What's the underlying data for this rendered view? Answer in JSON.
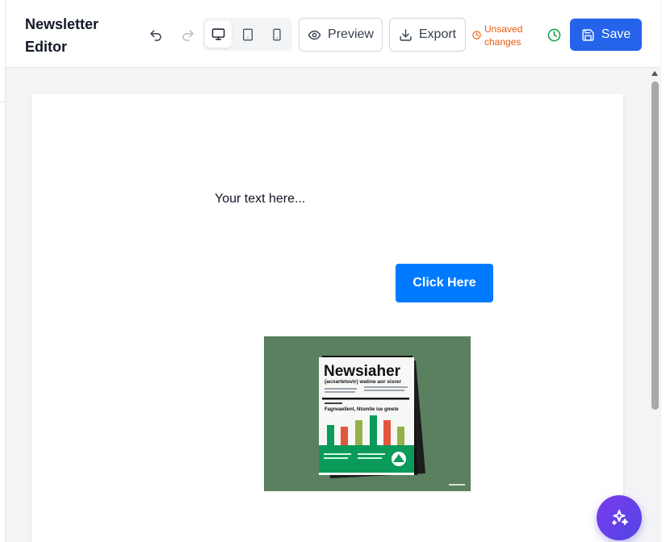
{
  "header": {
    "title": "Newsletter Editor",
    "preview_label": "Preview",
    "export_label": "Export",
    "status_text": "Unsaved changes",
    "save_label": "Save"
  },
  "canvas": {
    "text_block": "Your text here...",
    "button_label": "Click Here",
    "image": {
      "headline": "Newsiaher",
      "subhead": "(acnartetovir) watine aor sisrer",
      "caption": "Fagrwaellent, Ntumtie ise gmete"
    }
  },
  "colors": {
    "primary": "#2563eb",
    "cta": "#007bff",
    "unsaved": "#ea580c",
    "history": "#16a34a",
    "image_bg": "#5a8060"
  },
  "icons": [
    "undo-icon",
    "redo-icon",
    "desktop-icon",
    "tablet-icon",
    "mobile-icon",
    "eye-icon",
    "download-icon",
    "clock-icon",
    "history-icon",
    "save-icon",
    "sparkles-icon"
  ]
}
